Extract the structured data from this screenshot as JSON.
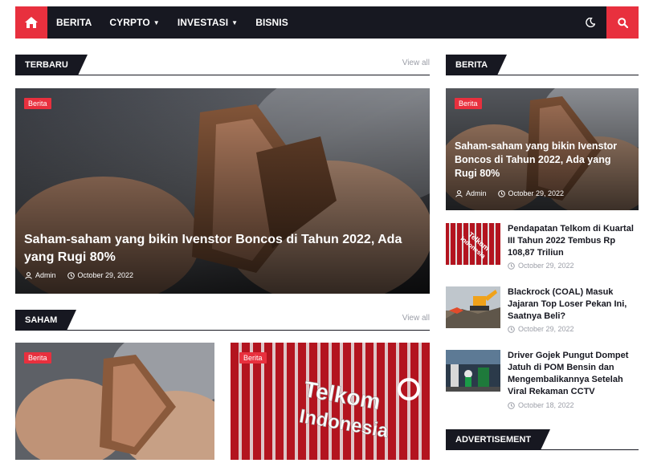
{
  "navbar": {
    "items": [
      {
        "label": "BERITA",
        "has_caret": false
      },
      {
        "label": "CYRPTO",
        "has_caret": true
      },
      {
        "label": "INVESTASI",
        "has_caret": true
      },
      {
        "label": "BISNIS",
        "has_caret": false
      }
    ],
    "icons": {
      "home": "home-icon",
      "theme": "moon-icon",
      "search": "search-icon"
    },
    "accent_color": "#e8303e",
    "bg_color": "#171821"
  },
  "terbaru": {
    "title": "TERBARU",
    "view_all": "View all",
    "featured": {
      "badge": "Berita",
      "title": "Saham-saham yang bikin Ivenstor Boncos di Tahun 2022, Ada yang Rugi 80%",
      "author": "Admin",
      "date": "October 29, 2022"
    }
  },
  "saham": {
    "title": "SAHAM",
    "view_all": "View all",
    "cards": [
      {
        "badge": "Berita"
      },
      {
        "badge": "Berita"
      }
    ]
  },
  "berita_sidebar": {
    "title": "BERITA",
    "featured": {
      "badge": "Berita",
      "title": "Saham-saham yang bikin Ivenstor Boncos di Tahun 2022, Ada yang Rugi 80%",
      "author": "Admin",
      "date": "October 29, 2022"
    },
    "items": [
      {
        "title": "Pendapatan Telkom di Kuartal III Tahun 2022 Tembus Rp 108,87 Triliun",
        "date": "October 29, 2022"
      },
      {
        "title": "Blackrock (COAL) Masuk Jajaran Top Loser Pekan Ini, Saatnya Beli?",
        "date": "October 29, 2022"
      },
      {
        "title": "Driver Gojek Pungut Dompet Jatuh di POM Bensin dan Mengembalikannya Setelah Viral Rekaman CCTV",
        "date": "October 18, 2022"
      }
    ]
  },
  "advertisement": {
    "title": "ADVERTISEMENT"
  },
  "thumb_text": {
    "telkom_line1": "Telkom",
    "telkom_line2": "Indonesia"
  }
}
